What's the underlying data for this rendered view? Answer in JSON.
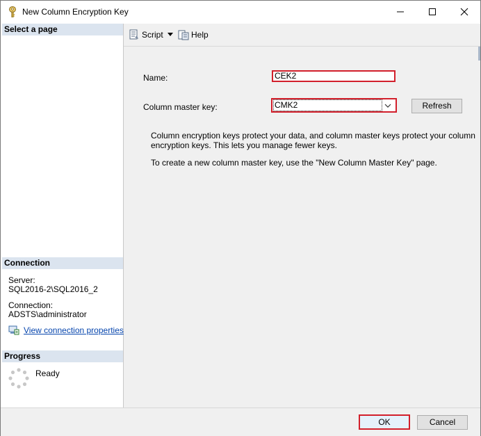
{
  "window": {
    "title": "New Column Encryption Key"
  },
  "left_pane": {
    "select_page_header": "Select a page",
    "connection_header": "Connection",
    "server_label": "Server:",
    "server_value": "SQL2016-2\\SQL2016_2",
    "connection_label": "Connection:",
    "connection_value": "ADSTS\\administrator",
    "view_properties_link": "View connection properties",
    "progress_header": "Progress",
    "progress_status": "Ready"
  },
  "toolbar": {
    "script_label": "Script",
    "help_label": "Help"
  },
  "form": {
    "name_label": "Name:",
    "name_value": "CEK2",
    "cmk_label": "Column master key:",
    "cmk_value": "CMK2",
    "refresh_label": "Refresh",
    "description_1": "Column encryption keys protect your data, and column master keys protect your column",
    "description_2": "encryption keys. This lets you manage fewer keys.",
    "description_3": "To create a new column master key, use the \"New Column Master Key\" page."
  },
  "footer": {
    "ok_label": "OK",
    "cancel_label": "Cancel"
  },
  "colors": {
    "highlight_border": "#d21f2b",
    "section_header_bg": "#dbe4ef",
    "link": "#0645ad"
  }
}
